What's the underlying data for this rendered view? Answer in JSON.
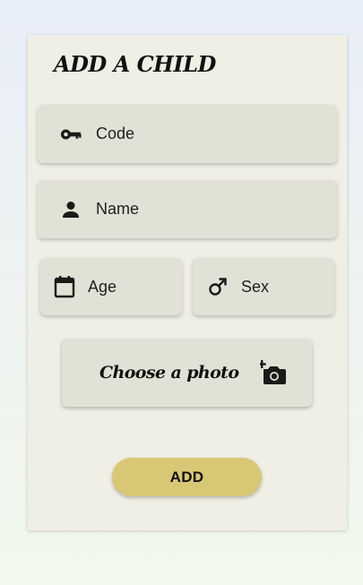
{
  "form": {
    "title": "ADD A CHILD",
    "code": {
      "placeholder": "Code",
      "icon": "key-icon"
    },
    "name": {
      "placeholder": "Name",
      "icon": "person-icon"
    },
    "age": {
      "placeholder": "Age",
      "icon": "calendar-icon"
    },
    "sex": {
      "placeholder": "Sex",
      "icon": "male-icon"
    },
    "photo": {
      "label": "Choose a photo",
      "icon": "add-camera-icon"
    },
    "submit_label": "ADD"
  },
  "colors": {
    "card_background": "#f0efe5",
    "field_background": "#e2e1d6",
    "accent": "#d8c775",
    "text": "#111111"
  }
}
